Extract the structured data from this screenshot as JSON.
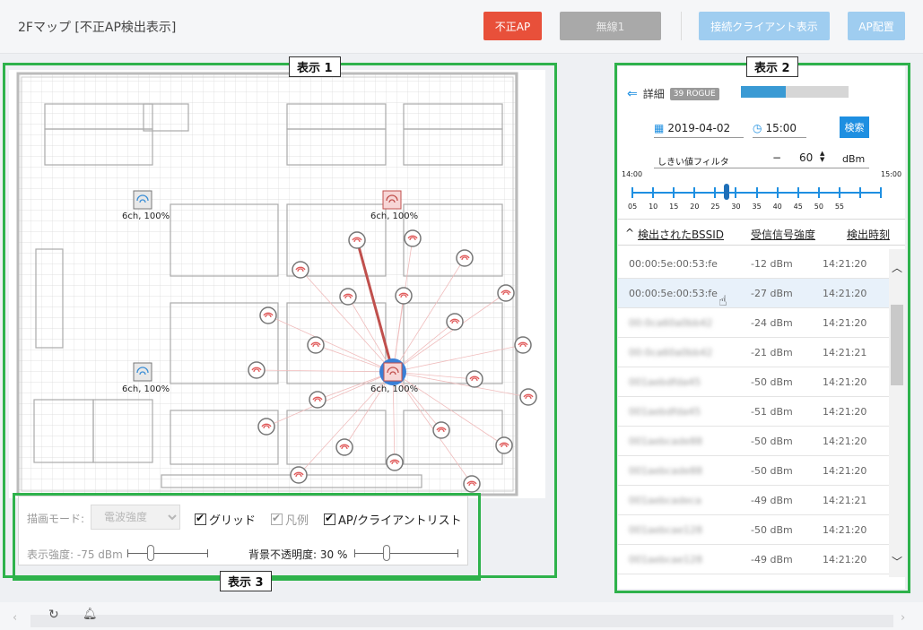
{
  "header": {
    "title": "2Fマップ [不正AP検出表示]",
    "rogue_ap_button": "不正AP",
    "radio_button": "無線1",
    "client_display_button": "接続クライアント表示",
    "ap_placement_button": "AP配置"
  },
  "panel_labels": {
    "panel1": "表示 1",
    "panel2": "表示 2",
    "panel3": "表示 3"
  },
  "map": {
    "access_points": [
      {
        "caption": "6ch, 100%",
        "status": "normal"
      },
      {
        "caption": "6ch, 100%",
        "status": "rogue"
      },
      {
        "caption": "6ch, 100%",
        "status": "normal"
      },
      {
        "caption": "6ch, 100%",
        "status": "rogue-selected"
      }
    ]
  },
  "controls": {
    "draw_mode_label": "描画モード:",
    "draw_mode_value": "電波強度",
    "grid_label": "グリッド",
    "legend_label": "凡例",
    "ap_list_label": "AP/クライアントリスト",
    "display_strength_label": "表示強度: -75 dBm",
    "bg_opacity_label": "背景不透明度: 30 %"
  },
  "details": {
    "title": "詳細",
    "rogue_badge": "39 ROGUE",
    "progress": 0.42,
    "date": "2019-04-02",
    "time": "15:00",
    "search_button": "検索",
    "threshold_label": "しきい値フィルタ",
    "threshold_minus": "−",
    "threshold_value": "60",
    "threshold_unit": "dBm",
    "time_start": "14:00",
    "time_end": "15:00",
    "time_ticks": [
      "05",
      "10",
      "15",
      "20",
      "25",
      "30",
      "35",
      "40",
      "45",
      "50",
      "55"
    ],
    "col_bssid": "検出されたBSSID",
    "col_signal": "受信信号強度",
    "col_time": "検出時刻",
    "rows": [
      {
        "bssid": "00:00:5e:00:53:fe",
        "signal": "-12 dBm",
        "time": "14:21:20",
        "blur": false
      },
      {
        "bssid": "00:00:5e:00:53:fe",
        "signal": "-27 dBm",
        "time": "14:21:20",
        "blur": false
      },
      {
        "bssid": "00:0ca60a0bb42",
        "signal": "-24 dBm",
        "time": "14:21:20",
        "blur": true
      },
      {
        "bssid": "00:0ca60a0bb42",
        "signal": "-21 dBm",
        "time": "14:21:21",
        "blur": true
      },
      {
        "bssid": "001aebdfda45",
        "signal": "-50 dBm",
        "time": "14:21:20",
        "blur": true
      },
      {
        "bssid": "001aebdfda45",
        "signal": "-51 dBm",
        "time": "14:21:20",
        "blur": true
      },
      {
        "bssid": "001aebcade88",
        "signal": "-50 dBm",
        "time": "14:21:20",
        "blur": true
      },
      {
        "bssid": "001aebcade88",
        "signal": "-50 dBm",
        "time": "14:21:20",
        "blur": true
      },
      {
        "bssid": "001aebcadeca",
        "signal": "-49 dBm",
        "time": "14:21:21",
        "blur": true
      },
      {
        "bssid": "001aebcae128",
        "signal": "-50 dBm",
        "time": "14:21:20",
        "blur": true
      },
      {
        "bssid": "001aebcae128",
        "signal": "-49 dBm",
        "time": "14:21:20",
        "blur": true
      }
    ]
  }
}
